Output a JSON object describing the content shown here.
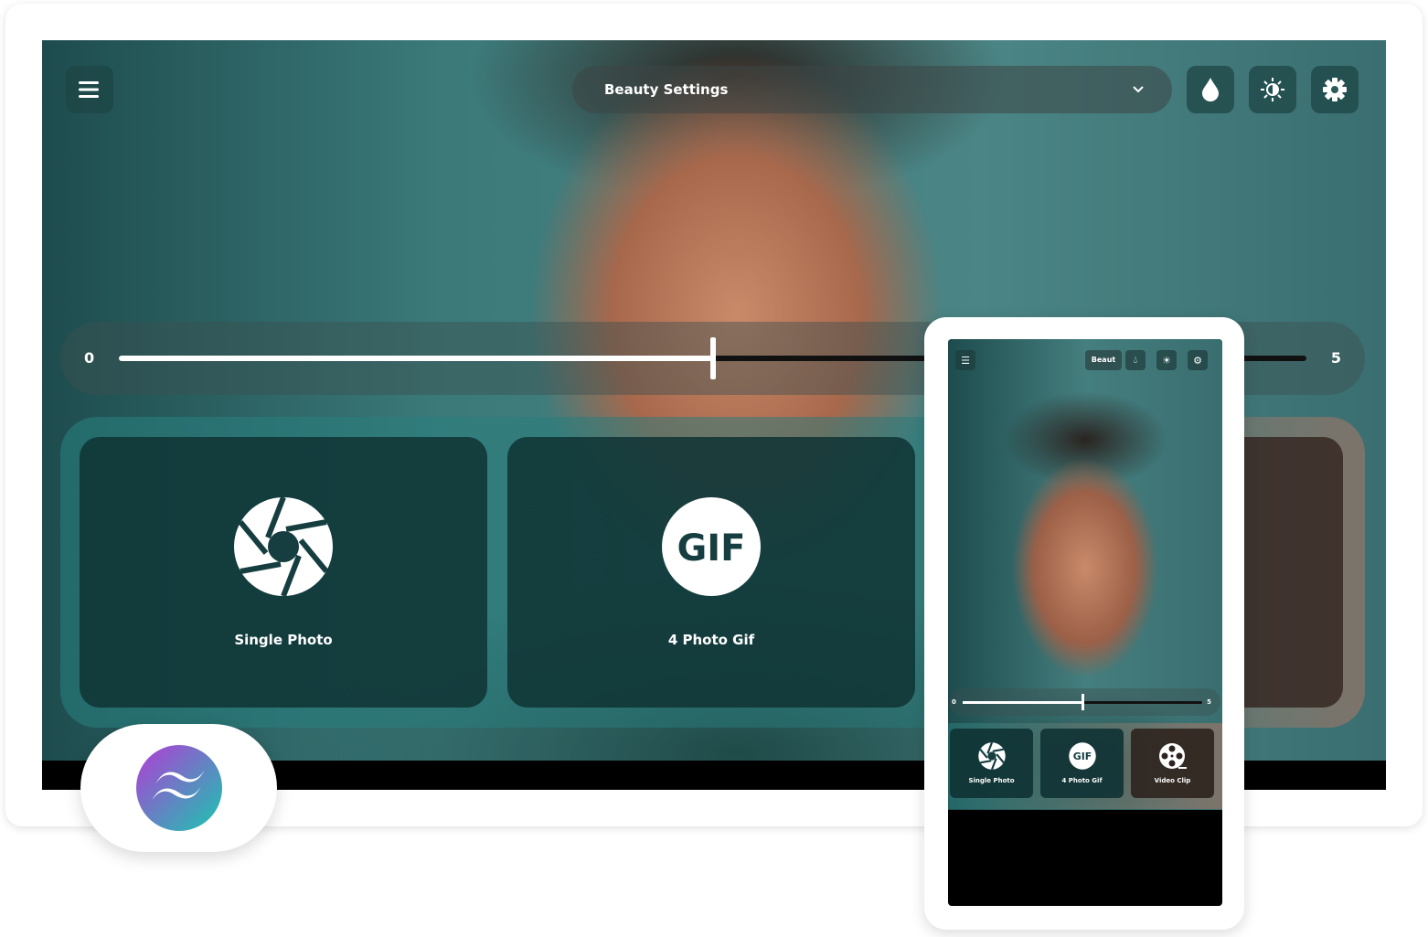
{
  "app": {
    "menu_icon": "hamburger-menu-icon",
    "select": {
      "value": "Beauty Settings",
      "icon": "chevron-down-icon"
    },
    "toolbar": [
      {
        "name": "color-drop-icon"
      },
      {
        "name": "brightness-icon"
      },
      {
        "name": "settings-gear-icon"
      }
    ],
    "slider": {
      "min_label": "0",
      "max_label": "5",
      "min": 0,
      "max": 5,
      "value": 2.5
    },
    "modes": [
      {
        "label": "Single Photo",
        "icon": "camera-aperture-icon"
      },
      {
        "label": "4 Photo Gif",
        "icon": "gif-icon",
        "icon_text": "GIF"
      },
      {
        "label": "Video Clip",
        "icon": "film-reel-icon"
      }
    ]
  },
  "mobile": {
    "select_value": "Beaut",
    "slider_min": "0",
    "slider_max": "5"
  },
  "badge": {
    "logo": "Tailwind CSS logo"
  }
}
